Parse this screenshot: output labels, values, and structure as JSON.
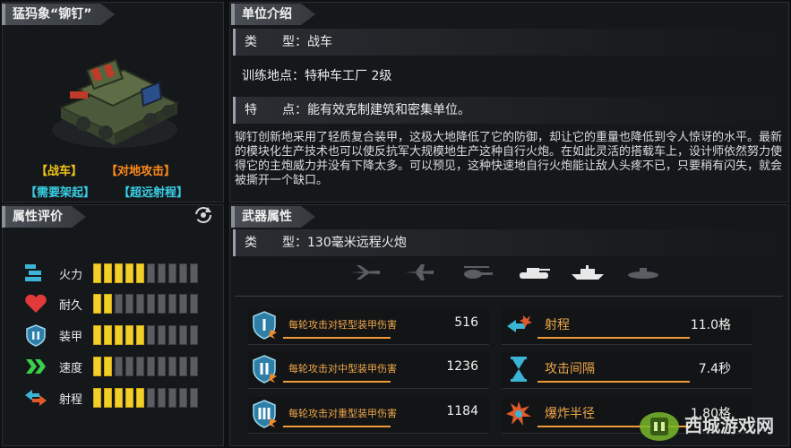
{
  "unit": {
    "name": "猛犸象“铆钉”",
    "tags": [
      "【战车】",
      "【对地攻击】",
      "【需要架起】",
      "【超远射程】"
    ]
  },
  "attributes_panel": {
    "title": "属性评价",
    "rows": [
      {
        "label": "火力",
        "icon": "firepower-icon",
        "level": 5,
        "max": 10
      },
      {
        "label": "耐久",
        "icon": "heart-icon",
        "level": 2,
        "max": 10
      },
      {
        "label": "装甲",
        "icon": "armor-shield-icon",
        "level": 5,
        "max": 10
      },
      {
        "label": "速度",
        "icon": "speed-chevron-icon",
        "level": 2,
        "max": 10
      },
      {
        "label": "射程",
        "icon": "range-arrow-icon",
        "level": 5,
        "max": 10
      }
    ]
  },
  "intro_panel": {
    "title": "单位介绍",
    "type_line": "类　　型：战车",
    "training_line": "训练地点：特种车工厂  2级",
    "feature_line": "特　　点：能有效克制建筑和密集单位。",
    "description": "铆钉创新地采用了轻质复合装甲，这极大地降低了它的防御，却让它的重量也降低到令人惊讶的水平。最新的模块化生产技术也可以使反抗军大规模地生产这种自行火炮。在如此灵活的搭载车上，设计师依然努力使得它的主炮威力并没有下降太多。可以预见，这种快速地自行火炮能让敌人头疼不已，只要稍有闪失，就会被撕开一个缺口。"
  },
  "weapon_panel": {
    "title": "武器属性",
    "type_line": "类　　型：130毫米远程火炮",
    "target_types": [
      "fighter-plane-icon",
      "bomber-plane-icon",
      "helicopter-icon",
      "tank-icon",
      "ship-icon",
      "submarine-icon"
    ],
    "damage": [
      {
        "label": "每轮攻击对轻型装甲伤害",
        "value": "516",
        "icon": "armor-light-icon"
      },
      {
        "label": "每轮攻击对中型装甲伤害",
        "value": "1236",
        "icon": "armor-medium-icon"
      },
      {
        "label": "每轮攻击对重型装甲伤害",
        "value": "1184",
        "icon": "armor-heavy-icon"
      }
    ],
    "stats": [
      {
        "label": "射程",
        "value": "11.0格",
        "icon": "range-icon"
      },
      {
        "label": "攻击间隔",
        "value": "7.4秒",
        "icon": "hourglass-icon"
      },
      {
        "label": "爆炸半径",
        "value": "1.80格",
        "icon": "explosion-icon"
      }
    ]
  },
  "watermark": {
    "text": "西城游戏网"
  },
  "colors": {
    "accent_yellow": "#f3cf2a",
    "accent_orange": "#f09a3a",
    "accent_cyan": "#38d0e6"
  }
}
